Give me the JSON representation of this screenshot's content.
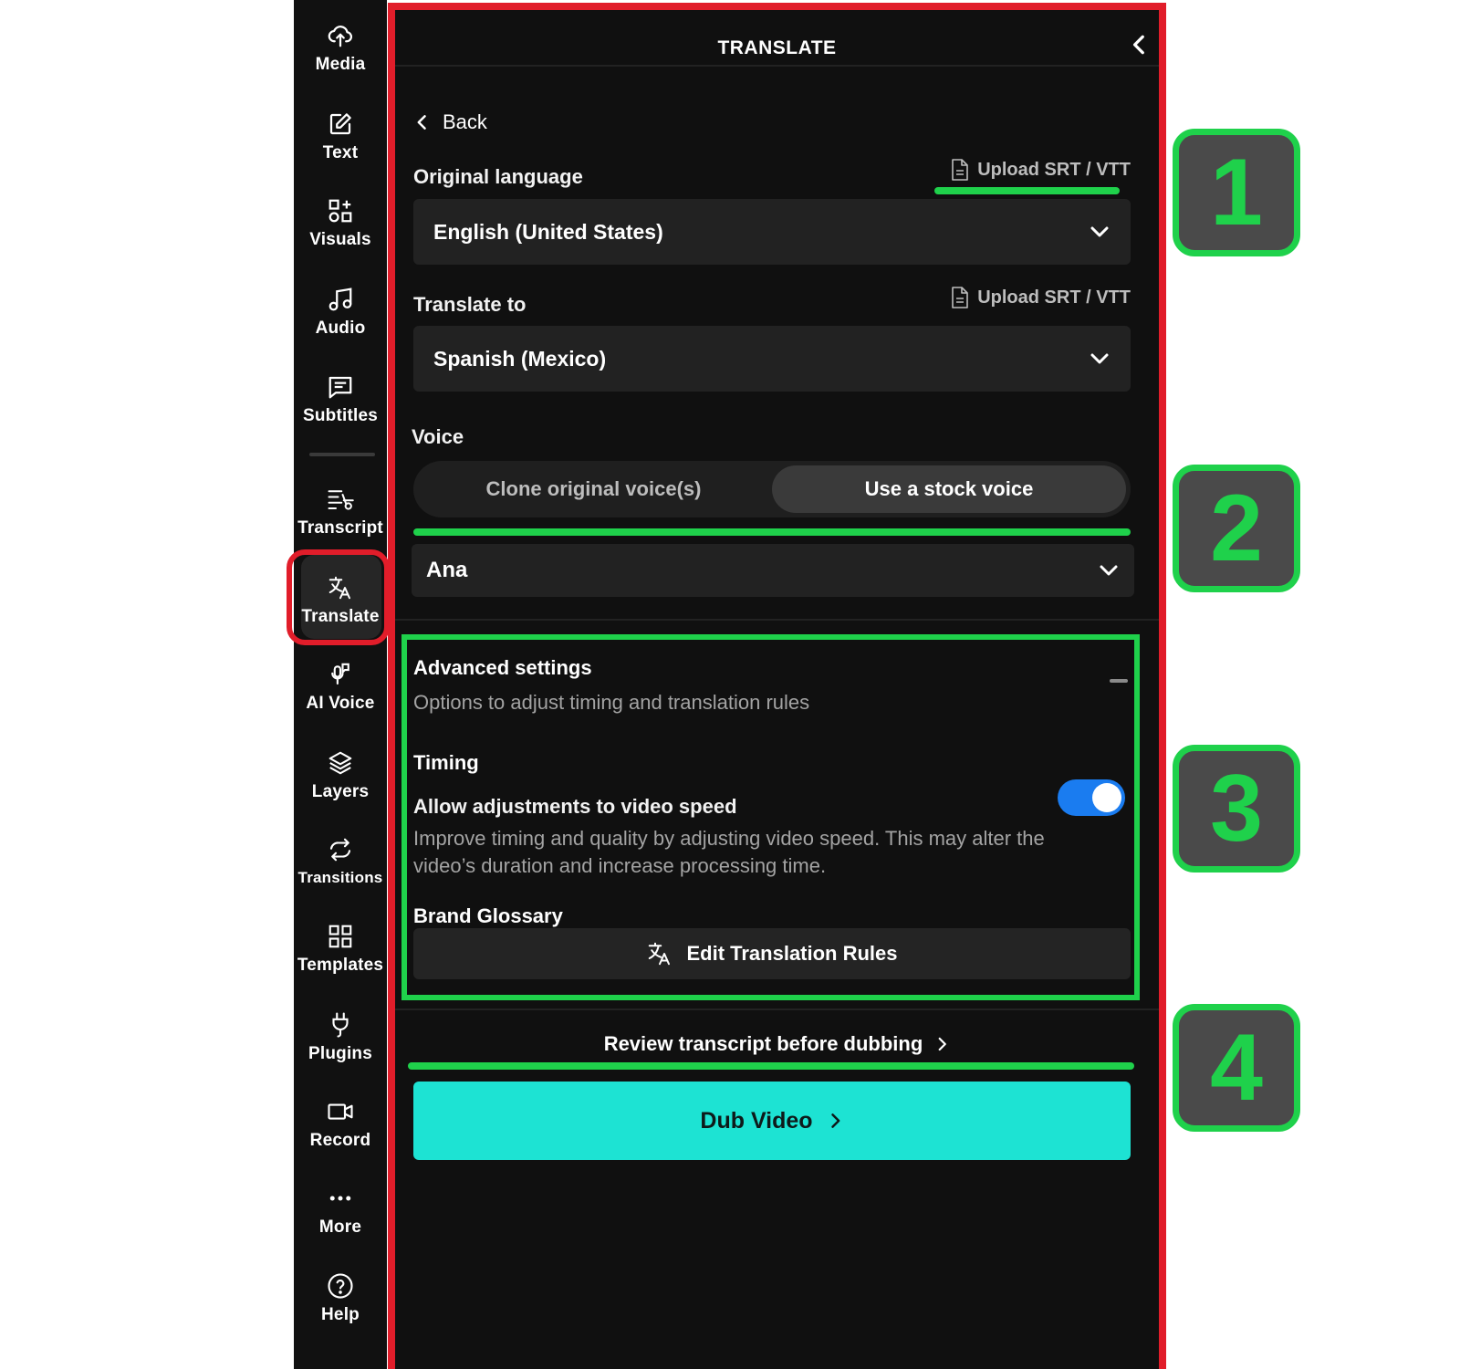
{
  "sidebar": {
    "items": [
      {
        "label": "Media",
        "icon": "upload-cloud-icon"
      },
      {
        "label": "Text",
        "icon": "edit-icon"
      },
      {
        "label": "Visuals",
        "icon": "shapes-icon"
      },
      {
        "label": "Audio",
        "icon": "music-note-icon"
      },
      {
        "label": "Subtitles",
        "icon": "subtitles-icon"
      },
      {
        "label": "Transcript",
        "icon": "transcript-cut-icon"
      },
      {
        "label": "Translate",
        "icon": "translate-icon"
      },
      {
        "label": "AI Voice",
        "icon": "microphone-icon"
      },
      {
        "label": "Layers",
        "icon": "layers-icon"
      },
      {
        "label": "Transitions",
        "icon": "transitions-icon"
      },
      {
        "label": "Templates",
        "icon": "grid-icon"
      },
      {
        "label": "Plugins",
        "icon": "plug-icon"
      },
      {
        "label": "Record",
        "icon": "video-camera-icon"
      },
      {
        "label": "More",
        "icon": "more-dots-icon"
      },
      {
        "label": "Help",
        "icon": "help-circle-icon"
      }
    ],
    "active": "Translate"
  },
  "panel": {
    "title": "TRANSLATE",
    "back_label": "Back",
    "original_language": {
      "label": "Original language",
      "upload_label": "Upload SRT / VTT",
      "value": "English (United States)"
    },
    "translate_to": {
      "label": "Translate to",
      "upload_label": "Upload SRT / VTT",
      "value": "Spanish (Mexico)"
    },
    "voice": {
      "label": "Voice",
      "options": [
        "Clone original voice(s)",
        "Use a stock voice"
      ],
      "selected": "Use a stock voice",
      "stock_voice": "Ana"
    },
    "advanced": {
      "title": "Advanced settings",
      "subtitle": "Options to adjust timing and translation rules",
      "timing_heading": "Timing",
      "speed_label": "Allow adjustments to video speed",
      "speed_enabled": true,
      "speed_description": "Improve timing and quality by adjusting video speed. This may alter the video’s duration and increase processing time.",
      "glossary_heading": "Brand Glossary",
      "edit_rules_label": "Edit Translation Rules"
    },
    "review_label": "Review transcript before dubbing",
    "dub_label": "Dub Video"
  },
  "annotations": [
    "1",
    "2",
    "3",
    "4"
  ],
  "colors": {
    "highlight_red": "#e11d2a",
    "highlight_green": "#1fd14b",
    "toggle_blue": "#1a7cf0",
    "dub_button": "#1de3d3"
  }
}
